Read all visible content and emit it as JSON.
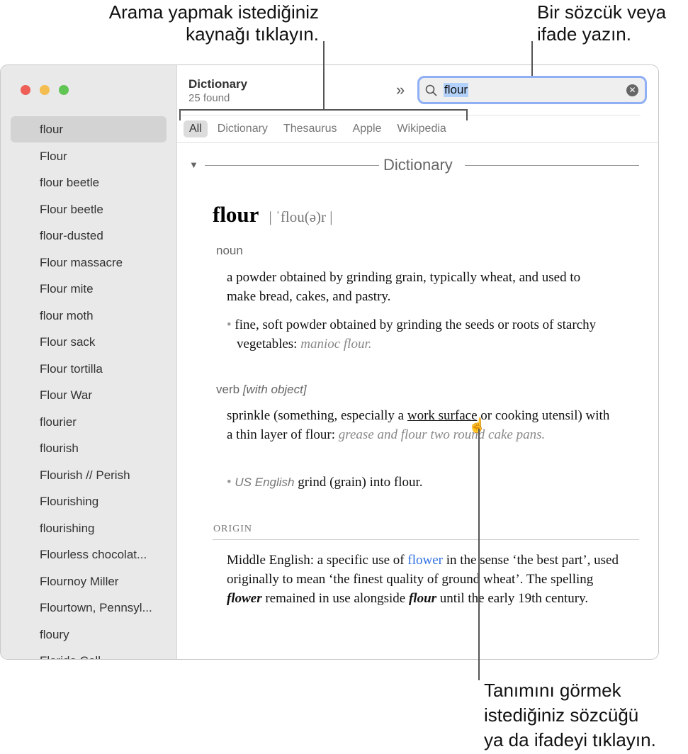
{
  "callouts": {
    "source": [
      "Arama yapmak istediğiniz",
      "kaynağı tıklayın."
    ],
    "type": [
      "Bir sözcük veya",
      "ifade yazın."
    ],
    "click": [
      "Tanımını görmek",
      "istediğiniz sözcüğü",
      "ya da ifadeyi tıklayın."
    ]
  },
  "sidebar": {
    "items": [
      "flour",
      "Flour",
      "flour beetle",
      "Flour beetle",
      "flour-dusted",
      "Flour massacre",
      "Flour mite",
      "flour moth",
      "Flour sack",
      "Flour tortilla",
      "Flour War",
      "flourier",
      "flourish",
      "Flourish // Perish",
      "Flourishing",
      "flourishing",
      "Flourless chocolat...",
      "Flournoy Miller",
      "Flourtown, Pennsyl...",
      "floury",
      "Florida Coll..."
    ]
  },
  "header": {
    "title": "Dictionary",
    "count": "25 found",
    "search_value": "flour"
  },
  "tabs": [
    "All",
    "Dictionary",
    "Thesaurus",
    "Apple",
    "Wikipedia"
  ],
  "entry": {
    "section": "Dictionary",
    "headword": "flour",
    "pron": "| ˈflou(ə)r |",
    "noun_label": "noun",
    "noun_def": "a powder obtained by grinding grain, typically wheat, and used to make bread, cakes, and pastry.",
    "noun_sub": "fine, soft powder obtained by grinding the seeds or roots of starchy vegetables:",
    "noun_sub_ex": "manioc flour.",
    "verb_label": "verb",
    "verb_qual": "[with object]",
    "verb_def_a": "sprinkle (something, especially a ",
    "verb_link": "work surface",
    "verb_def_b": " or cooking utensil) with a thin layer of flour:",
    "verb_ex": "grease and flour two round cake pans.",
    "verb_sub_reg": "US English",
    "verb_sub": "grind (grain) into flour.",
    "origin_label": "ORIGIN",
    "origin_a": "Middle English: a specific use of ",
    "origin_link": "flower",
    "origin_b": " in the sense ‘the best part’, used originally to mean ‘the finest quality of ground wheat’. The spelling ",
    "origin_i1": "flower",
    "origin_c": " remained in use alongside ",
    "origin_i2": "flour",
    "origin_d": " until the early 19th century."
  },
  "colors": {
    "accent": "#8fb0f5",
    "link": "#2f6fe0",
    "close": "#ed5f57",
    "min": "#f4bd4f",
    "max": "#61c554"
  }
}
